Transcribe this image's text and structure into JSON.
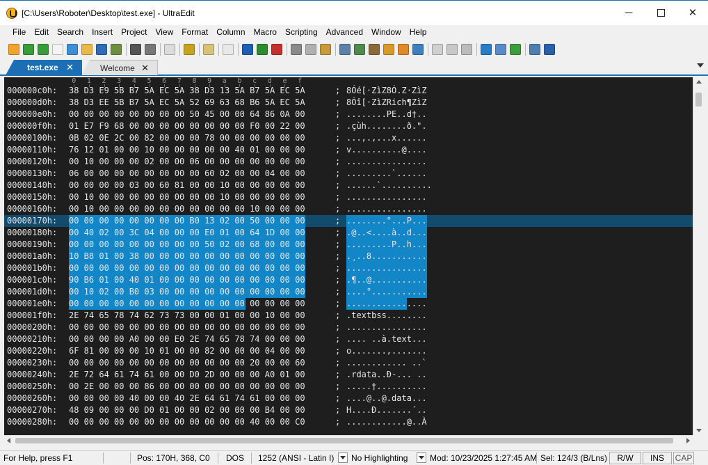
{
  "window": {
    "title": "[C:\\Users\\Roboter\\Desktop\\test.exe] - UltraEdit",
    "minimize": "─",
    "close": "✕"
  },
  "menu": [
    "File",
    "Edit",
    "Search",
    "Insert",
    "Project",
    "View",
    "Format",
    "Column",
    "Macro",
    "Scripting",
    "Advanced",
    "Window",
    "Help"
  ],
  "toolbar_icons": [
    {
      "name": "new-file-icon",
      "color": "#f2a32c"
    },
    {
      "name": "back-icon",
      "color": "#3a9b3a"
    },
    {
      "name": "forward-icon",
      "color": "#3a9b3a"
    },
    {
      "name": "new-document-icon",
      "color": "#f4f4f4"
    },
    {
      "name": "open-folder-icon",
      "color": "#3d8fd6"
    },
    {
      "name": "open-folder-alt-icon",
      "color": "#e8b84a"
    },
    {
      "name": "save-icon",
      "color": "#2f6cb5"
    },
    {
      "name": "save-as-icon",
      "color": "#6c8e3f"
    },
    {
      "sep": true
    },
    {
      "name": "print-icon",
      "color": "#555555"
    },
    {
      "name": "print-preview-icon",
      "color": "#777777"
    },
    {
      "sep": true
    },
    {
      "name": "document-list-icon",
      "color": "#dcdcdc"
    },
    {
      "sep": true
    },
    {
      "name": "hex-mode-icon",
      "color": "#c7a21b"
    },
    {
      "sep": true
    },
    {
      "name": "column-mode-icon",
      "color": "#d8c27a"
    },
    {
      "sep": true
    },
    {
      "name": "word-wrap-icon",
      "color": "#e8e8e8"
    },
    {
      "sep": true
    },
    {
      "name": "compile-icon",
      "color": "#1f5fb0"
    },
    {
      "name": "run-icon",
      "color": "#2e8b2e"
    },
    {
      "name": "stop-icon",
      "color": "#c42f2f"
    },
    {
      "sep": true
    },
    {
      "name": "cut-icon",
      "color": "#8a8a8a"
    },
    {
      "name": "copy-icon",
      "color": "#b0b0b0"
    },
    {
      "name": "paste-icon",
      "color": "#c79a3c"
    },
    {
      "sep": true
    },
    {
      "name": "find-icon",
      "color": "#5a7fa8"
    },
    {
      "name": "find-next-icon",
      "color": "#4f8a4f"
    },
    {
      "name": "replace-icon",
      "color": "#8a6a3a"
    },
    {
      "name": "find-in-files-icon",
      "color": "#d89a2a"
    },
    {
      "name": "replace-in-files-icon",
      "color": "#e08a2a"
    },
    {
      "name": "bookmark-icon",
      "color": "#3f7fbf"
    },
    {
      "sep": true
    },
    {
      "name": "tile-horizontal-icon",
      "color": "#d0d0d0"
    },
    {
      "name": "tile-vertical-icon",
      "color": "#c8c8c8"
    },
    {
      "name": "cascade-icon",
      "color": "#bcbcbc"
    },
    {
      "sep": true
    },
    {
      "name": "web-browser-icon",
      "color": "#2a7cc4"
    },
    {
      "name": "ftp-icon",
      "color": "#5a8ac8"
    },
    {
      "name": "refresh-icon",
      "color": "#3e9e3e"
    },
    {
      "sep": true
    },
    {
      "name": "layout-icon",
      "color": "#4f7fb0"
    },
    {
      "name": "help-icon",
      "color": "#2b5fa8"
    }
  ],
  "tabs": [
    {
      "label": "test.exe",
      "close": "✕"
    },
    {
      "label": "Welcome",
      "close": "✕"
    }
  ],
  "ruler": [
    "0",
    "1",
    "2",
    "3",
    "4",
    "5",
    "6",
    "7",
    "8",
    "9",
    "a",
    "b",
    "c",
    "d",
    "e",
    "f"
  ],
  "hex_rows": [
    {
      "addr": "000000c0h:",
      "hex": "38 D3 E9 5B B7 5A EC 5A 38 D3 13 5A B7 5A EC 5A",
      "ascii": "8Óé[·ZìZ8Ó.Z·ZìZ"
    },
    {
      "addr": "000000d0h:",
      "hex": "38 D3 EE 5B B7 5A EC 5A 52 69 63 68 B6 5A EC 5A",
      "ascii": "8Óî[·ZìZRich¶ZìZ"
    },
    {
      "addr": "000000e0h:",
      "hex": "00 00 00 00 00 00 00 00 50 45 00 00 64 86 0A 00",
      "ascii": "........PE..d†.."
    },
    {
      "addr": "000000f0h:",
      "hex": "01 E7 F9 68 00 00 00 00 00 00 00 00 F0 00 22 00",
      "ascii": ".çùh........ð.\"."
    },
    {
      "addr": "00000100h:",
      "hex": "0B 02 0E 2C 00 82 00 00 00 78 00 00 00 00 00 00",
      "ascii": "...,.‚...x......"
    },
    {
      "addr": "00000110h:",
      "hex": "76 12 01 00 00 10 00 00 00 00 00 40 01 00 00 00",
      "ascii": "v..........@...."
    },
    {
      "addr": "00000120h:",
      "hex": "00 10 00 00 00 02 00 00 06 00 00 00 00 00 00 00",
      "ascii": "................"
    },
    {
      "addr": "00000130h:",
      "hex": "06 00 00 00 00 00 00 00 00 60 02 00 00 04 00 00",
      "ascii": ".........`......"
    },
    {
      "addr": "00000140h:",
      "hex": "00 00 00 00 03 00 60 81 00 00 10 00 00 00 00 00",
      "ascii": "......`.........."
    },
    {
      "addr": "00000150h:",
      "hex": "00 10 00 00 00 00 00 00 00 00 10 00 00 00 00 00",
      "ascii": "................"
    },
    {
      "addr": "00000160h:",
      "hex": "00 10 00 00 00 00 00 00 00 00 00 00 10 00 00 00",
      "ascii": "................"
    },
    {
      "addr": "00000170h:",
      "hex": "00 00 00 00 00 00 00 00 B0 13 02 00 50 00 00 00",
      "ascii": "........°...P..."
    },
    {
      "addr": "00000180h:",
      "hex": "00 40 02 00 3C 04 00 00 00 E0 01 00 64 1D 00 00",
      "ascii": ".@..<....à..d..."
    },
    {
      "addr": "00000190h:",
      "hex": "00 00 00 00 00 00 00 00 00 50 02 00 68 00 00 00",
      "ascii": ".........P..h..."
    },
    {
      "addr": "000001a0h:",
      "hex": "10 B8 01 00 38 00 00 00 00 00 00 00 00 00 00 00",
      "ascii": ".¸..8..........."
    },
    {
      "addr": "000001b0h:",
      "hex": "00 00 00 00 00 00 00 00 00 00 00 00 00 00 00 00",
      "ascii": "................"
    },
    {
      "addr": "000001c0h:",
      "hex": "90 B6 01 00 40 01 00 00 00 00 00 00 00 00 00 00",
      "ascii": ".¶..@..........."
    },
    {
      "addr": "000001d0h:",
      "hex": "00 10 02 00 B0 03 00 00 00 00 00 00 00 00 00 00",
      "ascii": "....°..........."
    },
    {
      "addr": "000001e0h:",
      "hex": "00 00 00 00 00 00 00 00 00 00 00 00 00 00 00 00",
      "ascii": "................"
    },
    {
      "addr": "000001f0h:",
      "hex": "2E 74 65 78 74 62 73 73 00 00 01 00 00 10 00 00",
      "ascii": ".textbss........"
    },
    {
      "addr": "00000200h:",
      "hex": "00 00 00 00 00 00 00 00 00 00 00 00 00 00 00 00",
      "ascii": "................"
    },
    {
      "addr": "00000210h:",
      "hex": "00 00 00 00 A0 00 00 E0 2E 74 65 78 74 00 00 00",
      "ascii": ".... ..à.text..."
    },
    {
      "addr": "00000220h:",
      "hex": "6F 81 00 00 00 10 01 00 00 82 00 00 00 04 00 00",
      "ascii": "o.......‚......."
    },
    {
      "addr": "00000230h:",
      "hex": "00 00 00 00 00 00 00 00 00 00 00 00 20 00 00 60",
      "ascii": "............ ..`"
    },
    {
      "addr": "00000240h:",
      "hex": "2E 72 64 61 74 61 00 00 D0 2D 00 00 00 A0 01 00",
      "ascii": ".rdata..Ð-... .."
    },
    {
      "addr": "00000250h:",
      "hex": "00 2E 00 00 00 86 00 00 00 00 00 00 00 00 00 00",
      "ascii": ".....†.........."
    },
    {
      "addr": "00000260h:",
      "hex": "00 00 00 00 40 00 00 40 2E 64 61 74 61 00 00 00",
      "ascii": "....@..@.data..."
    },
    {
      "addr": "00000270h:",
      "hex": "48 09 00 00 00 D0 01 00 00 02 00 00 00 B4 00 00",
      "ascii": "H....Ð.......´.."
    },
    {
      "addr": "00000280h:",
      "hex": "00 00 00 00 00 00 00 00 00 00 00 00 40 00 00 C0",
      "ascii": "............@..À"
    }
  ],
  "status": {
    "help": "For Help, press F1",
    "position": "Pos: 170H, 368, C0",
    "line_ending": "DOS",
    "encoding": "1252  (ANSI - Latin I)",
    "highlighting": "No Highlighting",
    "modified": "Mod: 10/23/2025 1:27:45 AM",
    "selection": "Sel: 124/3 (B/Lns)",
    "rw": "R/W",
    "ins": "INS",
    "cap": "CAP"
  },
  "colors": {
    "accent": "#1c6fb5",
    "editor_bg": "#1e1e1e",
    "selection": "#1286c6",
    "caret_line": "#114c6e"
  }
}
